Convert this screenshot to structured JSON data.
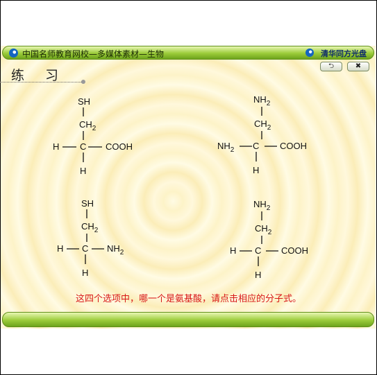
{
  "window": {
    "title": "中国名师教育网校—多媒体素材—生物",
    "brand": "清华同方光盘"
  },
  "toolbar": {
    "back_label": "⮌",
    "close_label": "✖"
  },
  "heading": "练习",
  "options": [
    {
      "top": "SH",
      "mid": "CH",
      "mid_sub": "2",
      "left": "H",
      "center": "C",
      "right": "COOH",
      "right_sub": "",
      "bottom": "H",
      "left_sub": ""
    },
    {
      "top": "NH",
      "top_sub": "2",
      "mid": "CH",
      "mid_sub": "2",
      "left": "NH",
      "left_sub": "2",
      "center": "C",
      "right": "COOH",
      "right_sub": "",
      "bottom": "H"
    },
    {
      "top": "SH",
      "mid": "CH",
      "mid_sub": "2",
      "left": "H",
      "left_sub": "",
      "center": "C",
      "right": "NH",
      "right_sub": "2",
      "bottom": "H"
    },
    {
      "top": "NH",
      "top_sub": "2",
      "mid": "CH",
      "mid_sub": "2",
      "left": "H",
      "left_sub": "",
      "center": "C",
      "right": "COOH",
      "right_sub": "",
      "bottom": "H"
    }
  ],
  "prompt": "这四个选项中，哪一个是氨基酸，请点击相应的分子式。"
}
